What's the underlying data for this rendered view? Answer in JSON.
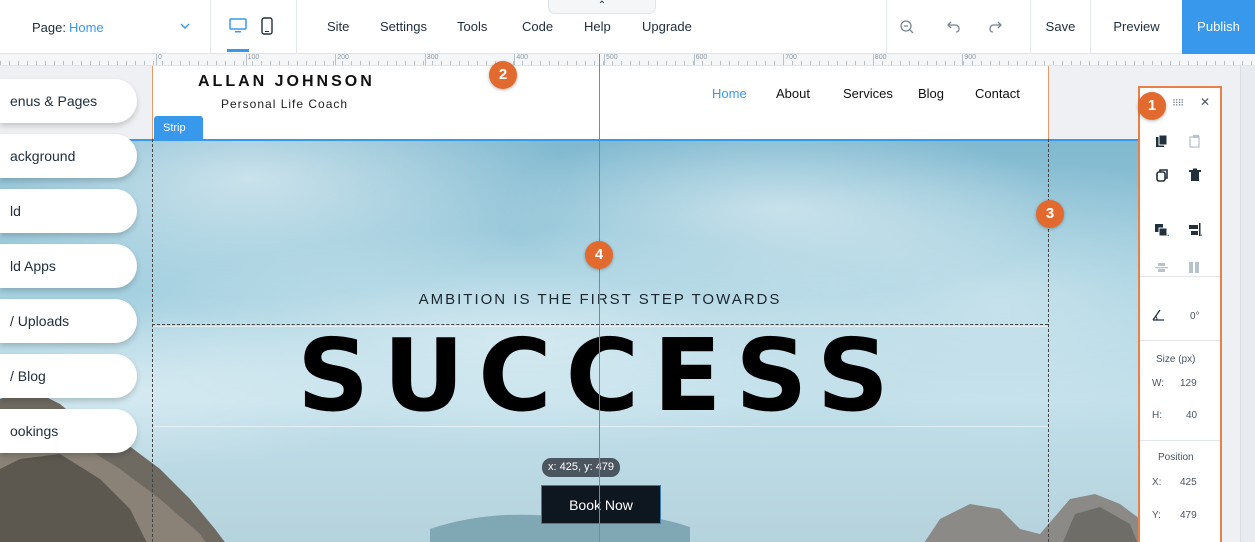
{
  "topbar": {
    "page_label": "Page:",
    "page_value": "Home",
    "menu": [
      "Site",
      "Settings",
      "Tools",
      "Code",
      "Help",
      "Upgrade"
    ],
    "help_notch": "⌃",
    "save": "Save",
    "preview": "Preview",
    "publish": "Publish"
  },
  "ruler": {
    "labels": [
      "0",
      "100",
      "200",
      "300",
      "400",
      "500",
      "600",
      "700",
      "800",
      "900"
    ]
  },
  "left_panel": {
    "items": [
      "enus & Pages",
      "ackground",
      "ld",
      "ld Apps",
      "/ Uploads",
      "/ Blog",
      "ookings"
    ]
  },
  "site": {
    "brand_name": "ALLAN JOHNSON",
    "brand_sub": "Personal Life Coach",
    "nav": [
      "Home",
      "About",
      "Services",
      "Blog",
      "Contact"
    ],
    "active_nav": "Home",
    "strip_tag": "Strip",
    "tagline": "AMBITION IS THE FIRST STEP TOWARDS",
    "headline": "SUCCESS",
    "cta": "Book Now",
    "coord_tip": "x: 425, y: 479"
  },
  "toolbar": {
    "rotation": "0°",
    "size_title": "Size (px)",
    "w_label": "W:",
    "w_value": "129",
    "h_label": "H:",
    "h_value": "40",
    "position_title": "Position",
    "x_label": "X:",
    "x_value": "425",
    "y_label": "Y:",
    "y_value": "479"
  },
  "callouts": [
    "1",
    "2",
    "3",
    "4"
  ],
  "colors": {
    "accent": "#3899ec",
    "callout": "#e36a2e",
    "selection_border": "#e8804a",
    "center_guide": "#d24fd6"
  }
}
